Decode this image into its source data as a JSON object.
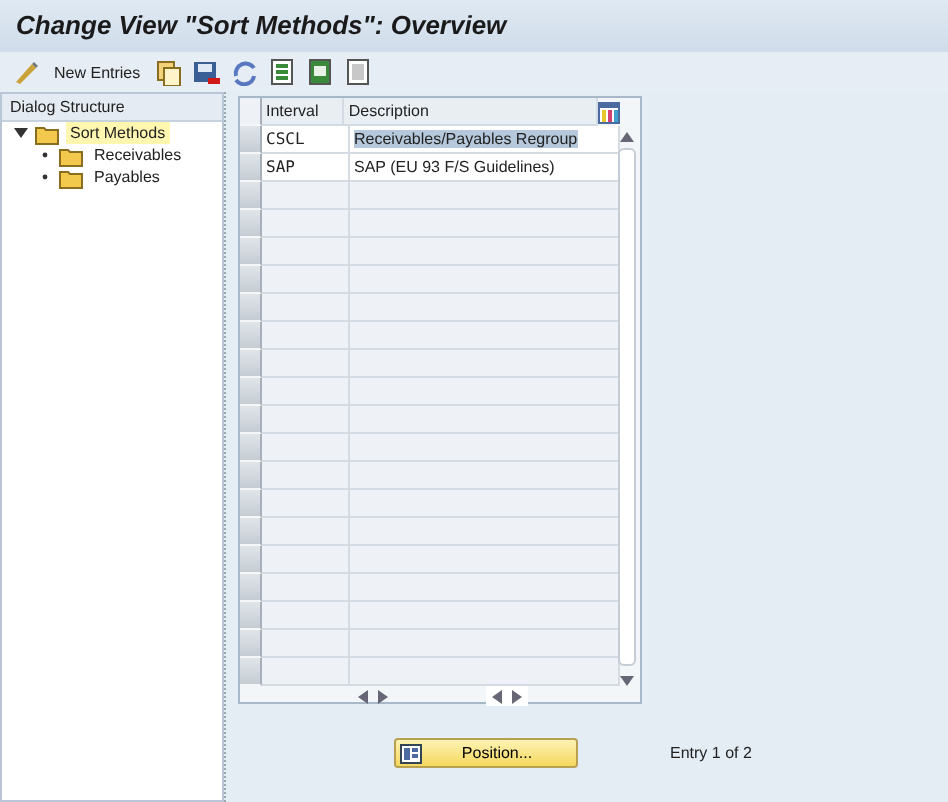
{
  "window": {
    "title": "Change View \"Sort Methods\": Overview"
  },
  "toolbar": {
    "items": [
      {
        "kind": "pencil-glasses"
      },
      {
        "kind": "text",
        "label": "New Entries"
      },
      {
        "kind": "copy"
      },
      {
        "kind": "save-delete"
      },
      {
        "kind": "undo"
      },
      {
        "kind": "select-all"
      },
      {
        "kind": "select-block"
      },
      {
        "kind": "deselect"
      }
    ]
  },
  "dialog_structure": {
    "title": "Dialog Structure",
    "items": [
      {
        "label": "Sort Methods",
        "selected": true,
        "expanded": true,
        "children": [
          {
            "label": "Receivables",
            "selected": false
          },
          {
            "label": "Payables",
            "selected": false
          }
        ]
      }
    ]
  },
  "table": {
    "columns": [
      "Interval",
      "Description"
    ],
    "rows": [
      {
        "cells": [
          "CSCL",
          "Receivables/Payables Regroup"
        ],
        "selected": true
      },
      {
        "cells": [
          "SAP",
          "SAP (EU 93 F/S Guidelines)"
        ],
        "selected": false
      }
    ]
  },
  "footer": {
    "button": "Position...",
    "entry": "Entry 1 of 2"
  }
}
